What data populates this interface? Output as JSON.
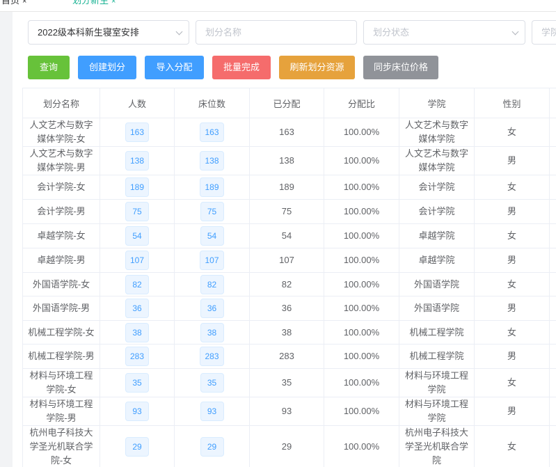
{
  "tabs": [
    {
      "label": "首页",
      "close": "×"
    },
    {
      "label": "划分新生",
      "close": "×"
    }
  ],
  "filters": {
    "semester_value": "2022级本科新生寝室安排",
    "name_placeholder": "划分名称",
    "status_placeholder": "划分状态",
    "college_placeholder": "学院"
  },
  "toolbar": {
    "query": "查询",
    "create": "创建划分",
    "import": "导入分配",
    "batch_complete": "批量完成",
    "refresh": "刷新划分资源",
    "sync_price": "同步床位价格"
  },
  "colors": {
    "query": "#67c23a",
    "create": "#409eff",
    "import": "#409eff",
    "batch_complete": "#f56c6c",
    "refresh": "#e6a23c",
    "sync_price": "#909399"
  },
  "table": {
    "headers": [
      "划分名称",
      "人数",
      "床位数",
      "已分配",
      "分配比",
      "学院",
      "性别"
    ],
    "rows": [
      {
        "name": "人文艺术与数字媒体学院-女",
        "count": "163",
        "beds": "163",
        "assigned": "163",
        "ratio": "100.00%",
        "college": "人文艺术与数字媒体学院",
        "gender": "女"
      },
      {
        "name": "人文艺术与数字媒体学院-男",
        "count": "138",
        "beds": "138",
        "assigned": "138",
        "ratio": "100.00%",
        "college": "人文艺术与数字媒体学院",
        "gender": "男"
      },
      {
        "name": "会计学院-女",
        "count": "189",
        "beds": "189",
        "assigned": "189",
        "ratio": "100.00%",
        "college": "会计学院",
        "gender": "女"
      },
      {
        "name": "会计学院-男",
        "count": "75",
        "beds": "75",
        "assigned": "75",
        "ratio": "100.00%",
        "college": "会计学院",
        "gender": "男"
      },
      {
        "name": "卓越学院-女",
        "count": "54",
        "beds": "54",
        "assigned": "54",
        "ratio": "100.00%",
        "college": "卓越学院",
        "gender": "女"
      },
      {
        "name": "卓越学院-男",
        "count": "107",
        "beds": "107",
        "assigned": "107",
        "ratio": "100.00%",
        "college": "卓越学院",
        "gender": "男"
      },
      {
        "name": "外国语学院-女",
        "count": "82",
        "beds": "82",
        "assigned": "82",
        "ratio": "100.00%",
        "college": "外国语学院",
        "gender": "女"
      },
      {
        "name": "外国语学院-男",
        "count": "36",
        "beds": "36",
        "assigned": "36",
        "ratio": "100.00%",
        "college": "外国语学院",
        "gender": "男"
      },
      {
        "name": "机械工程学院-女",
        "count": "38",
        "beds": "38",
        "assigned": "38",
        "ratio": "100.00%",
        "college": "机械工程学院",
        "gender": "女"
      },
      {
        "name": "机械工程学院-男",
        "count": "283",
        "beds": "283",
        "assigned": "283",
        "ratio": "100.00%",
        "college": "机械工程学院",
        "gender": "男"
      },
      {
        "name": "材料与环境工程学院-女",
        "count": "35",
        "beds": "35",
        "assigned": "35",
        "ratio": "100.00%",
        "college": "材料与环境工程学院",
        "gender": "女"
      },
      {
        "name": "材料与环境工程学院-男",
        "count": "93",
        "beds": "93",
        "assigned": "93",
        "ratio": "100.00%",
        "college": "材料与环境工程学院",
        "gender": "男"
      },
      {
        "name": "杭州电子科技大学圣光机联合学院-女",
        "count": "29",
        "beds": "29",
        "assigned": "29",
        "ratio": "100.00%",
        "college": "杭州电子科技大学圣光机联合学院",
        "gender": "女"
      }
    ]
  }
}
